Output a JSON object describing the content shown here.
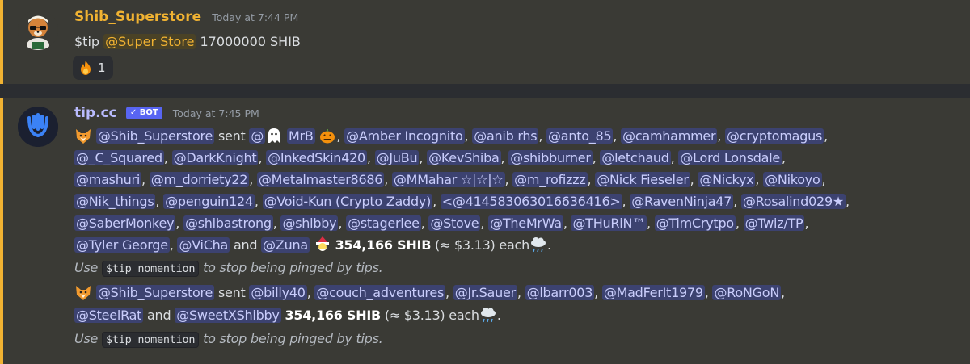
{
  "msg1": {
    "author": "Shib_Superstore",
    "timestamp": "Today at 7:44 PM",
    "cmd": "$tip",
    "mention": "@Super Store",
    "rest": "17000000 SHIB",
    "reaction_count": "1"
  },
  "msg2": {
    "author": "tip.cc",
    "badge": "BOT",
    "timestamp": "Today at 7:45 PM",
    "sender": "@Shib_Superstore",
    "sent": "sent",
    "and": "and",
    "each": "each",
    "recipients1": [
      "@",
      "MrB",
      "@Amber Incognito",
      "@anib rhs",
      "@anto_85",
      "@camhammer",
      "@cryptomagus",
      "@_C_Squared",
      "@DarkKnight",
      "@InkedSkin420",
      "@JuBu",
      "@KevShiba",
      "@shibburner",
      "@letchaud",
      "@Lord Lonsdale",
      "@mashuri",
      "@m_dorriety22",
      "@Metalmaster8686",
      "@MMahar ☆|☆|☆",
      "@m_rofizzz",
      "@Nick Fieseler",
      "@Nickyx",
      "@Nikoyo",
      "@Nik_things",
      "@penguin124",
      "@Void-Kun (Crypto Zaddy)",
      "<@414583063016636416>",
      "@RavenNinja47",
      "@Rosalind029★",
      "@SaberMonkey",
      "@shibastrong",
      "@shibby",
      "@stagerlee",
      "@Stove",
      "@TheMrWa",
      "@THuRiN™",
      "@TimCrytpo",
      "@Twiz/TP",
      "@Tyler George",
      "@ViCha",
      "@Zuna"
    ],
    "amount1": "354,166 SHIB",
    "usd1": "(≈ $3.13)",
    "hint_use": "Use",
    "hint_code": "$tip nomention",
    "hint_rest": "to stop being pinged by tips.",
    "recipients2": [
      "@billy40",
      "@couch_adventures",
      "@Jr.Sauer",
      "@lbarr003",
      "@MadFerIt1979",
      "@RoNGoN",
      "@SteelRat",
      "@SweetXShibby"
    ],
    "amount2": "354,166 SHIB",
    "usd2": "(≈ $3.13)"
  },
  "colors": {
    "background": "#313338",
    "highlight_bar": "#f0b232",
    "mention_bg": "#3c4270",
    "bot_badge": "#5865f2"
  }
}
